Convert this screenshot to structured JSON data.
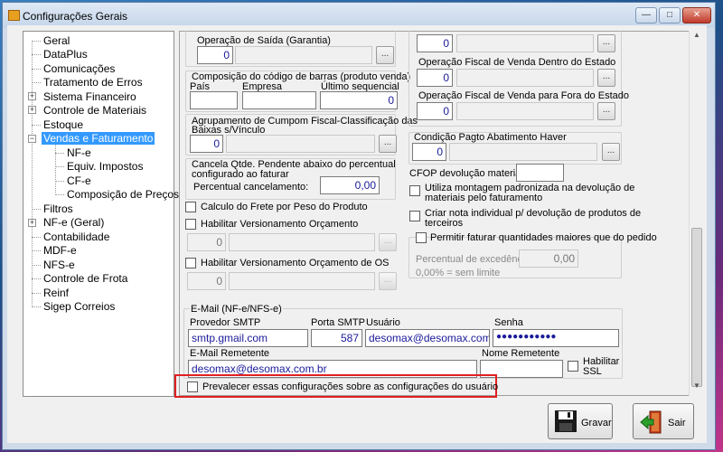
{
  "window": {
    "title": "Configurações Gerais",
    "controls": {
      "minimize": "—",
      "maximize": "□",
      "close": "✕"
    }
  },
  "tree": {
    "items": [
      {
        "label": "Geral"
      },
      {
        "label": "DataPlus"
      },
      {
        "label": "Comunicações"
      },
      {
        "label": "Tratamento de Erros"
      },
      {
        "label": "Sistema Financeiro"
      },
      {
        "label": "Controle de Materiais"
      },
      {
        "label": "Estoque"
      },
      {
        "label": "Vendas e Faturamento"
      },
      {
        "label": "NF-e"
      },
      {
        "label": "Equiv. Impostos"
      },
      {
        "label": "CF-e"
      },
      {
        "label": "Composição de Preços"
      },
      {
        "label": "Filtros"
      },
      {
        "label": "NF-e (Geral)"
      },
      {
        "label": "Contabilidade"
      },
      {
        "label": "MDF-e"
      },
      {
        "label": "NFS-e"
      },
      {
        "label": "Controle de Frota"
      },
      {
        "label": "Reinf"
      },
      {
        "label": "Sigep Correios"
      }
    ],
    "selected": "Vendas e Faturamento",
    "expand_plus": "+",
    "expand_minus": "−"
  },
  "left": {
    "op_saida": {
      "label": "Operação de Saída (Garantia)",
      "value": "0"
    },
    "barcode": {
      "title": "Composição do código de barras (produto venda)",
      "pais_label": "País",
      "empresa_label": "Empresa",
      "ultimo_label": "Último sequencial",
      "ultimo_value": "0"
    },
    "agrupamento": {
      "label_line1": "Agrupamento de Cumpom Fiscal-Classificação das",
      "label_line2": "Baixas s/Vínculo",
      "value": "0"
    },
    "cancela": {
      "label_line1": "Cancela Qtde. Pendente abaixo do percentual",
      "label_line2": "configurado ao faturar",
      "percent_label": "Percentual cancelamento:",
      "percent_value": "0,00"
    },
    "calculo_frete": "Calculo do Frete por Peso do Produto",
    "versionamento_orcamento": {
      "label": "Habilitar Versionamento Orçamento",
      "value": "0"
    },
    "versionamento_os": {
      "label": "Habilitar Versionamento Orçamento de OS",
      "value": "0"
    }
  },
  "right": {
    "top_value": "0",
    "op_dentro": {
      "label": "Operação Fiscal de Venda Dentro do Estado",
      "value": "0"
    },
    "op_fora": {
      "label": "Operação Fiscal de Venda para Fora do Estado",
      "value": "0"
    },
    "cond_pagto": {
      "label": "Condição Pagto Abatimento Haver",
      "value": "0"
    },
    "cfop_label": "CFOP devolução materiais:",
    "utiliza_montagem_line1": "Utiliza montagem padronizada na devolução de",
    "utiliza_montagem_line2": "materiais pelo faturamento",
    "criar_nota_line1": "Criar nota individual p/ devolução de produtos de",
    "criar_nota_line2": "terceiros",
    "permitir_faturar": "Permitir faturar quantidades maiores que do pedido",
    "percentual_excedencia_label": "Percentual de excedência:",
    "percentual_excedencia_value": "0,00",
    "sem_limite_note": "0,00% = sem limite"
  },
  "email": {
    "group_title": "E-Mail (NF-e/NFS-e)",
    "smtp_label": "Provedor SMTP",
    "smtp_value": "smtp.gmail.com",
    "porta_label": "Porta SMTP",
    "porta_value": "587",
    "usuario_label": "Usuário",
    "usuario_value": "desomax@desomax.com",
    "senha_label": "Senha",
    "senha_value": "●●●●●●●●●●●",
    "remetente_label": "E-Mail Remetente",
    "remetente_value": "desomax@desomax.com.br",
    "nome_remetente_label": "Nome Remetente",
    "nome_remetente_value": "",
    "ssl_line1": "Habilitar",
    "ssl_line2": "SSL"
  },
  "prevalecer": "Prevalecer essas configurações sobre as configurações do usuário",
  "buttons": {
    "gravar": "Gravar",
    "sair": "Sair"
  },
  "ellipsis": "..."
}
